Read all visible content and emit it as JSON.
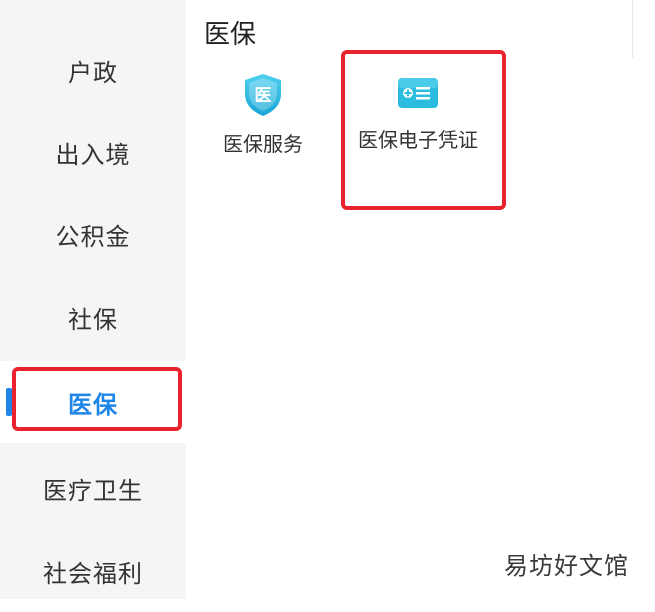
{
  "sidebar": {
    "items": [
      {
        "label": "户政"
      },
      {
        "label": "出入境"
      },
      {
        "label": "公积金"
      },
      {
        "label": "社保"
      },
      {
        "label": "医保"
      },
      {
        "label": "医疗卫生"
      },
      {
        "label": "社会福利"
      }
    ],
    "active_index": 4
  },
  "main": {
    "section_title": "医保",
    "services": [
      {
        "label": "医保服务",
        "icon": "medical-insurance-shield-icon",
        "icon_text": "医"
      },
      {
        "label": "医保电子凭证",
        "icon": "medical-e-voucher-card-icon"
      }
    ]
  },
  "watermark": "易坊好文馆",
  "colors": {
    "accent": "#1f86e8",
    "highlight": "#e8232d",
    "sidebar_bg": "#f5f5f5",
    "icon_teal": "#27b6d9"
  }
}
